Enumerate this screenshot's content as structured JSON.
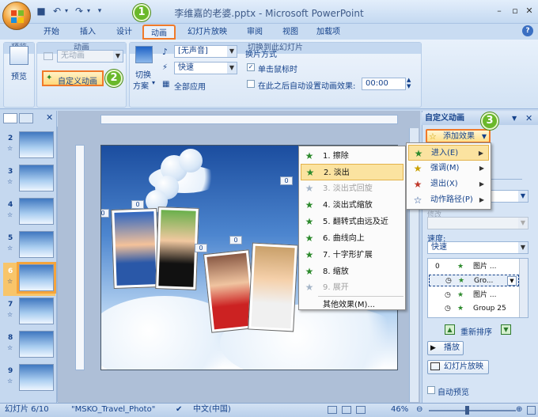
{
  "window": {
    "title": "李维嘉的老婆.pptx - Microsoft PowerPoint",
    "accent": "#f5a43c"
  },
  "tabs": [
    {
      "label": "开始"
    },
    {
      "label": "插入"
    },
    {
      "label": "设计"
    },
    {
      "label": "动画"
    },
    {
      "label": "幻灯片放映"
    },
    {
      "label": "审阅"
    },
    {
      "label": "视图"
    },
    {
      "label": "加载项"
    }
  ],
  "ribbon": {
    "preview_group": {
      "label": "预览",
      "button": "预览"
    },
    "animation_group": {
      "label": "动画",
      "animate_combo": "无动画",
      "custom_animation_button": "自定义动画"
    },
    "transition_group": {
      "label": "切换到此幻灯片",
      "switch_scheme_line1": "切换",
      "switch_scheme_line2": "方案",
      "sound_combo": "[无声音]",
      "speed_combo": "快速",
      "apply_all": "全部应用",
      "advance_title": "换片方式",
      "on_click": "单击鼠标时",
      "auto_after": "在此之后自动设置动画效果:",
      "auto_time": "00:00"
    }
  },
  "callouts": [
    "1",
    "2",
    "3"
  ],
  "slides": [
    {
      "num": "2"
    },
    {
      "num": "3"
    },
    {
      "num": "4"
    },
    {
      "num": "5"
    },
    {
      "num": "6"
    },
    {
      "num": "7"
    },
    {
      "num": "8"
    },
    {
      "num": "9"
    }
  ],
  "slide_tags": [
    "0",
    "0",
    "0",
    "0",
    "0"
  ],
  "effects_menu": {
    "items": [
      {
        "label": "1. 擦除",
        "disabled": false
      },
      {
        "label": "2. 淡出",
        "disabled": false
      },
      {
        "label": "3. 淡出式回旋",
        "disabled": true
      },
      {
        "label": "4. 淡出式缩放",
        "disabled": false
      },
      {
        "label": "5. 翻转式由远及近",
        "disabled": false
      },
      {
        "label": "6. 曲线向上",
        "disabled": false
      },
      {
        "label": "7. 十字形扩展",
        "disabled": false
      },
      {
        "label": "8. 缩放",
        "disabled": false
      },
      {
        "label": "9. 展开",
        "disabled": true
      }
    ],
    "more": "其他效果(M)..."
  },
  "add_effect_menu": {
    "items": [
      {
        "label": "进入(E)",
        "icon_color": "#2c8a2c"
      },
      {
        "label": "强调(M)",
        "icon_color": "#c9a100"
      },
      {
        "label": "退出(X)",
        "icon_color": "#c0392b"
      },
      {
        "label": "动作路径(P)",
        "icon_color": "#15428b"
      }
    ]
  },
  "task_pane": {
    "title": "自定义动画",
    "add_effect": "添加效果",
    "modify_label": "修改",
    "speed_label": "速度:",
    "speed_value": "快速",
    "list": [
      {
        "index": "0",
        "name": "图片 ..."
      },
      {
        "index": "",
        "name": "Gro..."
      },
      {
        "index": "",
        "name": "图片 ..."
      },
      {
        "index": "",
        "name": "Group 25"
      }
    ],
    "reorder": "重新排序",
    "play": "播放",
    "slideshow": "幻灯片放映",
    "autopreview": "自动预览"
  },
  "statusbar": {
    "slide": "幻灯片 6/10",
    "theme": "\"MSKO_Travel_Photo\"",
    "lang": "中文(中国)",
    "zoom": "46%"
  }
}
